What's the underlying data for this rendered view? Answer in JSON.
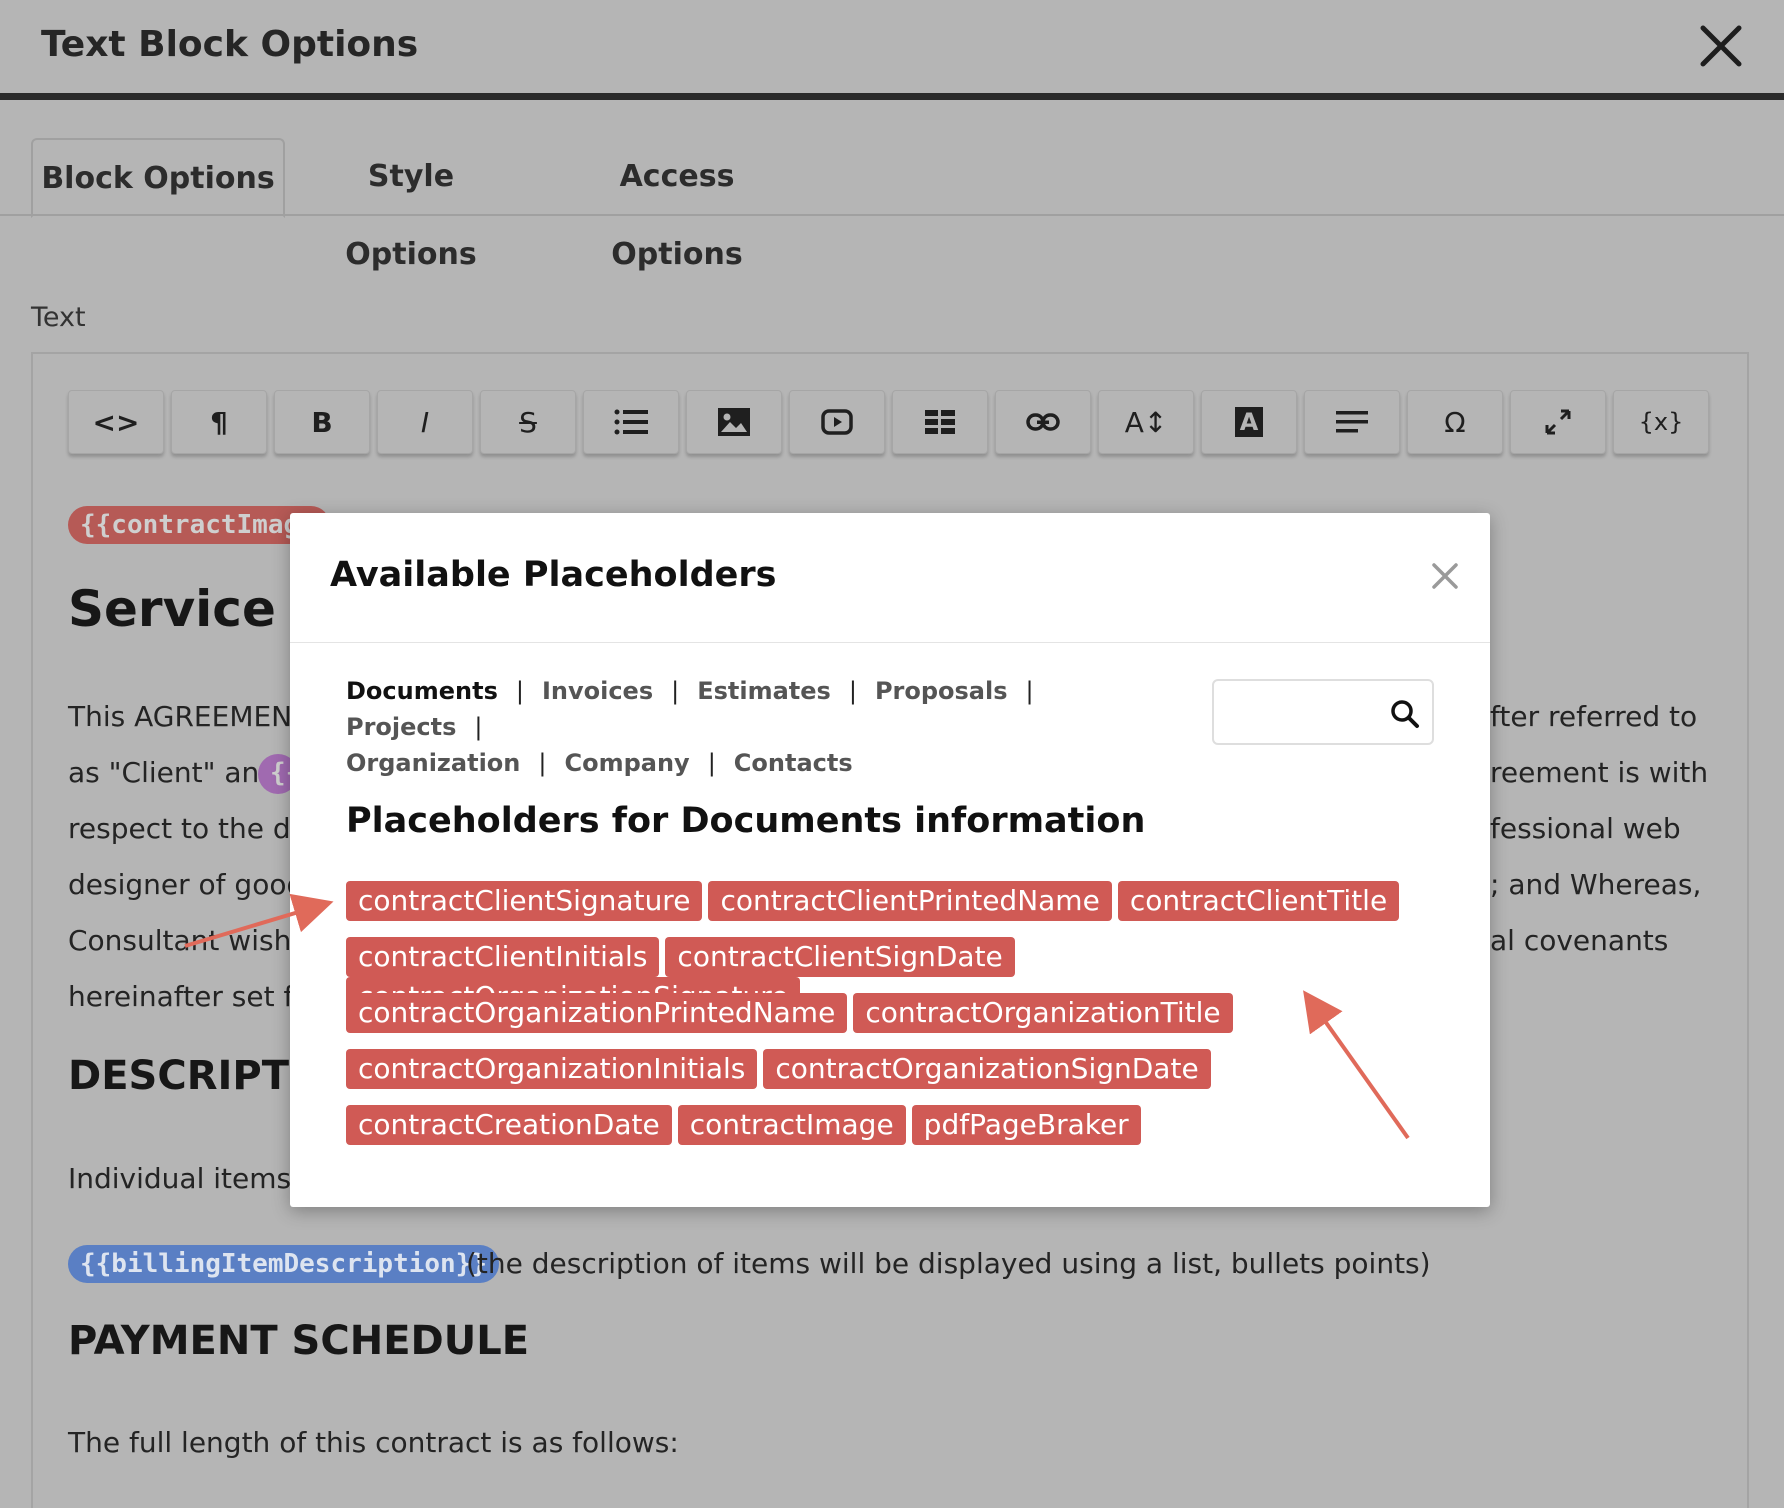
{
  "header": {
    "title": "Text Block Options"
  },
  "tabs": [
    {
      "label": "Block Options",
      "active": true
    },
    {
      "label": "Style Options",
      "active": false
    },
    {
      "label": "Access Options",
      "active": false
    }
  ],
  "editor": {
    "label": "Text",
    "toolbar": [
      {
        "icon": "code-view-icon",
        "text": "<>"
      },
      {
        "icon": "paragraph-icon",
        "text": "¶"
      },
      {
        "icon": "bold-icon",
        "text": "B"
      },
      {
        "icon": "italic-icon",
        "text": "I"
      },
      {
        "icon": "strikethrough-icon",
        "text": "S"
      },
      {
        "icon": "list-icon",
        "text": ""
      },
      {
        "icon": "image-icon",
        "text": ""
      },
      {
        "icon": "video-icon",
        "text": ""
      },
      {
        "icon": "table-icon",
        "text": ""
      },
      {
        "icon": "link-icon",
        "text": ""
      },
      {
        "icon": "font-size-icon",
        "text": "A↕"
      },
      {
        "icon": "text-color-icon",
        "text": "A"
      },
      {
        "icon": "align-icon",
        "text": ""
      },
      {
        "icon": "special-char-icon",
        "text": "Ω"
      },
      {
        "icon": "fullscreen-icon",
        "text": ""
      },
      {
        "icon": "placeholder-icon",
        "text": "{x}"
      }
    ],
    "content": {
      "image_placeholder": "{{contractImage",
      "heading": "Service A",
      "para_lines_left": [
        "This AGREEMENT i",
        "as \"Client\" and",
        "respect to the des",
        "designer of good s",
        "Consultant wishes",
        "hereinafter set fo"
      ],
      "para_lines_right": [
        "fter referred to",
        "reement is with",
        "fessional web",
        "; and Whereas,",
        "al covenants"
      ],
      "inline_placeholder": "{{",
      "section_description": "DESCRIPTI",
      "items_line": "Individual items i",
      "billing_placeholder": "{{billingItemDescription}}",
      "billing_note": "(the description of items will be displayed using a list, bullets points)",
      "section_payment": "PAYMENT SCHEDULE",
      "contract_length": "The full length of this contract is as follows:"
    }
  },
  "modal": {
    "title": "Available Placeholders",
    "categories": [
      "Documents",
      "Invoices",
      "Estimates",
      "Proposals",
      "Projects",
      "Organization",
      "Company",
      "Contacts"
    ],
    "active_category": "Documents",
    "search": {
      "value": "",
      "placeholder": ""
    },
    "section_title": "Placeholders for Documents information",
    "placeholder_rows": [
      [
        "contractClientSignature",
        "contractClientPrintedName",
        "contractClientTitle"
      ],
      [
        "contractClientInitials",
        "contractClientSignDate",
        "contractOrganizationSignature"
      ],
      [
        "contractOrganizationPrintedName",
        "contractOrganizationTitle"
      ],
      [
        "contractOrganizationInitials",
        "contractOrganizationSignDate"
      ],
      [
        "contractCreationDate",
        "contractImage",
        "pdfPageBraker"
      ]
    ]
  },
  "colors": {
    "overlay_bg": "#b5b5b5",
    "chip": "#d05a55",
    "arrow": "#e06a5a",
    "placeholder_blue": "#5a7fc4"
  }
}
